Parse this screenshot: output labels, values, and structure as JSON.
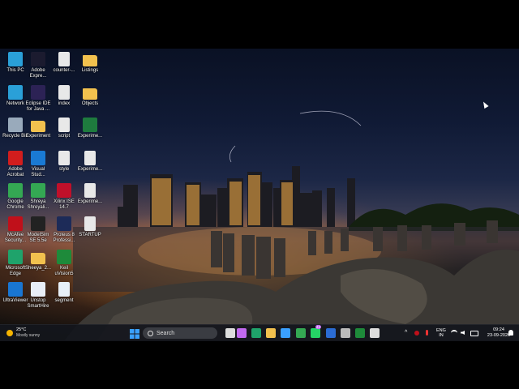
{
  "desktop_icons": [
    {
      "label": "This PC",
      "icon": "this-pc-icon",
      "color": "#2aa0d8"
    },
    {
      "label": "Network",
      "icon": "network-icon",
      "color": "#2aa0d8"
    },
    {
      "label": "Recycle Bin",
      "icon": "recycle-bin-icon",
      "color": "#9ab"
    },
    {
      "label": "Adobe\nAcrobat",
      "icon": "acrobat-icon",
      "color": "#d21d1d"
    },
    {
      "label": "Google\nChrome",
      "icon": "chrome-icon",
      "color": "#34a853"
    },
    {
      "label": "McAfee\nSecurity...",
      "icon": "mcafee-icon",
      "color": "#c0101a"
    },
    {
      "label": "Microsoft\nEdge",
      "icon": "edge-icon",
      "color": "#1fa36b"
    },
    {
      "label": "UltraViewer",
      "icon": "ultraviewer-icon",
      "color": "#1976d2"
    },
    {
      "label": "Adobe\nExpre...",
      "icon": "adobe-express-icon",
      "color": "#1b1b2f"
    },
    {
      "label": "Eclipse IDE\nfor Java ...",
      "icon": "eclipse-icon",
      "color": "#2c2255"
    },
    {
      "label": "Experiment",
      "icon": "folder-icon",
      "color": "#f2c14e"
    },
    {
      "label": "Visual\nStud...",
      "icon": "vscode-icon",
      "color": "#1a7ad4"
    },
    {
      "label": "Shreya\nShreyali...",
      "icon": "chrome-profile-icon",
      "color": "#34a853"
    },
    {
      "label": "ModelSim\nSE 5.5e",
      "icon": "modelsim-icon",
      "color": "#222"
    },
    {
      "label": "Sheeya_2...",
      "icon": "folder-icon",
      "color": "#f2c14e"
    },
    {
      "label": "Unstop\nSmartHire",
      "icon": "unstop-icon",
      "color": "#e8eef7"
    },
    {
      "label": "counter-...",
      "icon": "file-icon",
      "color": "#e8e8e8"
    },
    {
      "label": "index",
      "icon": "file-icon",
      "color": "#e8e8e8"
    },
    {
      "label": "script",
      "icon": "file-icon",
      "color": "#e8e8e8"
    },
    {
      "label": "style",
      "icon": "file-icon",
      "color": "#e8e8e8"
    },
    {
      "label": "Xilinx ISE\n14.7",
      "icon": "xilinx-icon",
      "color": "#c0102a"
    },
    {
      "label": "Proteus 8\nProfessi...",
      "icon": "proteus-icon",
      "color": "#1d2b58"
    },
    {
      "label": "Keil\nuVision5",
      "icon": "keil-icon",
      "color": "#1e8a3a"
    },
    {
      "label": "segment",
      "icon": "c-file-icon",
      "color": "#e8f0f8"
    },
    {
      "label": "Listings",
      "icon": "folder-icon",
      "color": "#f2c14e"
    },
    {
      "label": "Objects",
      "icon": "folder-icon",
      "color": "#f2c14e"
    },
    {
      "label": "Experime...",
      "icon": "excel-icon",
      "color": "#1e7b3e"
    },
    {
      "label": "Experime...",
      "icon": "file-icon",
      "color": "#e8e8e8"
    },
    {
      "label": "Experime...",
      "icon": "file-icon",
      "color": "#e8e8e8"
    },
    {
      "label": "STARTUP",
      "icon": "file-icon",
      "color": "#e8e8e8"
    }
  ],
  "weather": {
    "temp": "25°C",
    "condition": "Mostly sunny"
  },
  "taskbar": {
    "search_placeholder": "Search",
    "apps": [
      {
        "icon": "windows-start-icon",
        "color": "#3aa0ff"
      },
      {
        "icon": "task-view-icon",
        "color": "#ddd"
      },
      {
        "icon": "copilot-icon",
        "color": "#c26af0"
      },
      {
        "icon": "edge-icon",
        "color": "#1fa36b"
      },
      {
        "icon": "file-explorer-icon",
        "color": "#f2c14e"
      },
      {
        "icon": "store-icon",
        "color": "#3aa0ff"
      },
      {
        "icon": "chrome-icon",
        "color": "#34a853"
      },
      {
        "icon": "whatsapp-icon",
        "color": "#25d366"
      },
      {
        "icon": "word-icon",
        "color": "#2b6cd4"
      },
      {
        "icon": "modelsim-icon",
        "color": "#bbb"
      },
      {
        "icon": "keil-icon",
        "color": "#1e8a3a"
      },
      {
        "icon": "notepad-icon",
        "color": "#ddd"
      }
    ],
    "badge_count": "43"
  },
  "tray": {
    "language": "ENG\nIN",
    "time": "09:24",
    "date": "23-09-2026"
  }
}
